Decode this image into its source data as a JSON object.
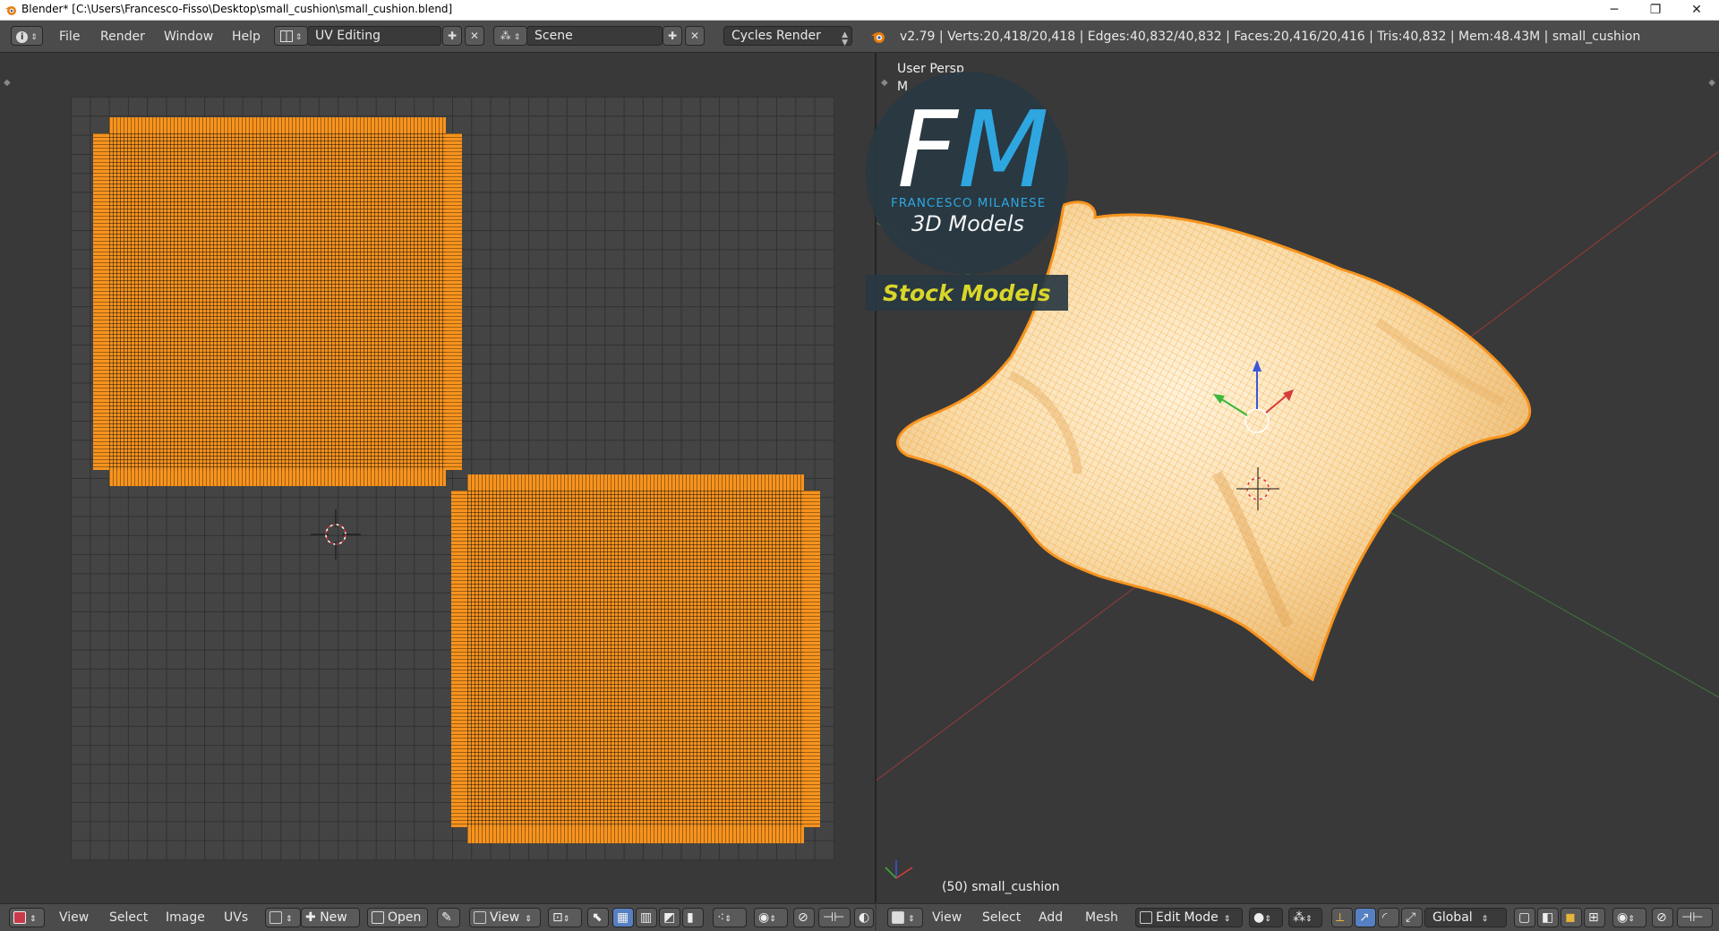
{
  "window": {
    "title": "Blender* [C:\\Users\\Francesco-Fisso\\Desktop\\small_cushion\\small_cushion.blend]",
    "minimize": "─",
    "restore": "❐",
    "close": "✕"
  },
  "info_header": {
    "menus": [
      "File",
      "Render",
      "Window",
      "Help"
    ],
    "layout": "UV Editing",
    "scene": "Scene",
    "engine": "Cycles Render",
    "stats": "v2.79 | Verts:20,418/20,418 | Edges:40,832/40,832 | Faces:20,416/20,416 | Tris:40,832 | Mem:48.43M | small_cushion"
  },
  "viewport": {
    "view_name": "User Persp",
    "mode_label": "M",
    "object_label": "(50) small_cushion"
  },
  "watermark": {
    "letter_f": "F",
    "letter_m": "M",
    "name": "FRANCESCO MILANESE",
    "subtitle": "3D Models",
    "tag": "Stock Models"
  },
  "uv_header": {
    "menus": [
      "View",
      "Select",
      "Image",
      "UVs"
    ],
    "new": "New",
    "open": "Open",
    "view": "View"
  },
  "view3d_header": {
    "menus": [
      "View",
      "Select",
      "Add",
      "Mesh"
    ],
    "mode": "Edit Mode",
    "orientation": "Global"
  },
  "colors": {
    "selection_orange": "#f39220",
    "header_bg": "#4b4b4b",
    "editor_bg": "#393939",
    "watermark_blue": "#2ea7e0",
    "watermark_yellow": "#d9d62a"
  }
}
